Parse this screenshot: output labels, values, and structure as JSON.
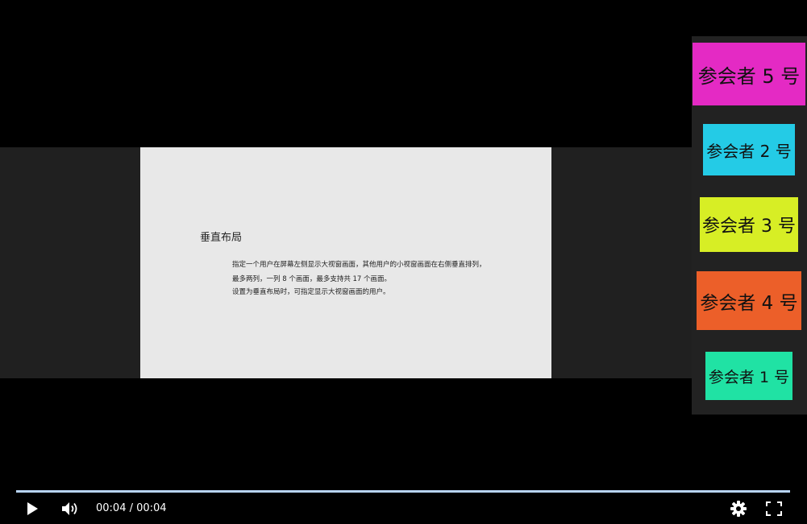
{
  "slide": {
    "title": "垂直布局",
    "lines": [
      "指定一个用户在屏幕左侧显示大视窗画面，其他用户的小视窗画面在右侧垂直排列，",
      "最多两列，一列 8 个画面，最多支持共 17 个画面。",
      "设置为垂直布局时，可指定显示大视窗画面的用户。"
    ]
  },
  "participants": [
    {
      "label": "参会者 5 号",
      "color": "#e42ac4"
    },
    {
      "label": "参会者 2 号",
      "color": "#24cbe6"
    },
    {
      "label": "参会者 3 号",
      "color": "#d7ee25"
    },
    {
      "label": "参会者 4 号",
      "color": "#ec5f29"
    },
    {
      "label": "参会者 1 号",
      "color": "#20e2a4"
    }
  ],
  "player": {
    "time_display": "00:04 / 00:04",
    "progress_fraction": 1.0,
    "play_icon": "play-icon",
    "volume_icon": "volume-icon",
    "settings_icon": "gear-icon",
    "fullscreen_icon": "fullscreen-icon"
  }
}
